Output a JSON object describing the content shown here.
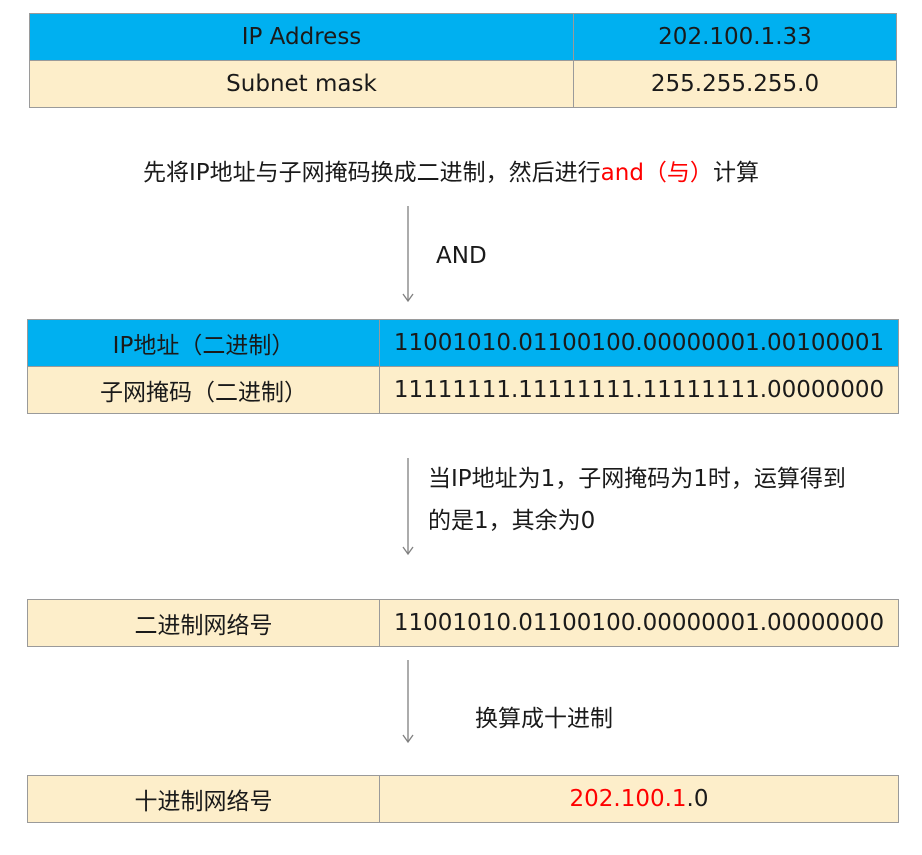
{
  "table1": {
    "rows": [
      {
        "label": "IP Address",
        "value": "202.100.1.33"
      },
      {
        "label": "Subnet mask",
        "value": "255.255.255.0"
      }
    ]
  },
  "step1": {
    "text_before": "先将IP地址与子网掩码换成二进制，然后进行",
    "text_highlight": "and（与）",
    "text_after": "计算"
  },
  "arrow1_label": "AND",
  "table2": {
    "rows": [
      {
        "label": "IP地址（二进制）",
        "value": "11001010.01100100.00000001.00100001"
      },
      {
        "label": "子网掩码（二进制）",
        "value": "11111111.11111111.11111111.00000000"
      }
    ]
  },
  "step2": {
    "line1": "当IP地址为1，子网掩码为1时，运算得到",
    "line2": "的是1，其余为0"
  },
  "table3": {
    "label": "二进制网络号",
    "value": "11001010.01100100.00000001.00000000"
  },
  "step3": {
    "text": "换算成十进制"
  },
  "table4": {
    "label": "十进制网络号",
    "value_highlight": "202.100.1",
    "value_rest": ".0"
  },
  "colors": {
    "header_blue": "#00b0f0",
    "cell_cream": "#fdeeca",
    "highlight_red": "#ff0000",
    "border_gray": "#9a9a9a"
  }
}
